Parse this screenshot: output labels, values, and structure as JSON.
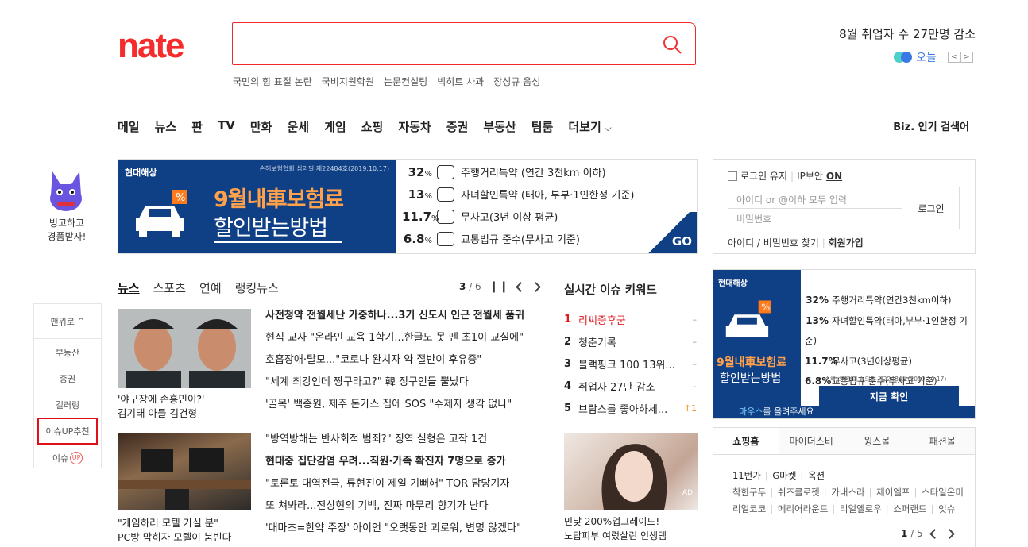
{
  "header": {
    "logo": "nate",
    "search_placeholder": "",
    "suggestions": [
      "국민의 힘 표절 논란",
      "국비지원학원",
      "논문컨설팅",
      "빅히트 사과",
      "장성규 음성"
    ],
    "headline": "8월 취업자 수 27만명 감소",
    "today_label": "오늘",
    "prev": "<",
    "next": ">"
  },
  "nav": {
    "items": [
      "메일",
      "뉴스",
      "판",
      "TV",
      "만화",
      "운세",
      "게임",
      "쇼핑",
      "자동차",
      "증권",
      "부동산",
      "팀룸"
    ],
    "more": "더보기",
    "biz": "Biz. 인기 검색어"
  },
  "left": {
    "mascot_text_1": "빙고하고",
    "mascot_text_2": "경품받자!",
    "top_label": "맨위로",
    "items": [
      "부동산",
      "증권",
      "컬러링",
      "이슈UP추천"
    ],
    "last_item": "이슈",
    "up_badge": "UP"
  },
  "banner": {
    "brand": "현대해상",
    "cert": "손해보험협회 심의필 제22484호(2019.10.17)",
    "headline_1": "9월내車보험료",
    "headline_2": "할인받는방법",
    "lines": [
      {
        "pct": "32",
        "text": "주행거리특약 (연간 3천km 이하)"
      },
      {
        "pct": "13",
        "text": "자녀할인특약 (태아, 부부·1인한정 기준)"
      },
      {
        "pct": "11.7",
        "text": "무사고(3년 이상 평균)"
      },
      {
        "pct": "6.8",
        "text": "교통법규 준수(무사고 기준)"
      }
    ],
    "pct_unit": "%",
    "go": "GO"
  },
  "login": {
    "keep": "로그인 유지",
    "ip_security": "IP보안",
    "ip_state": "ON",
    "id_placeholder": "아이디 or @이하 모두 입력",
    "pw_placeholder": "비밀번호",
    "button": "로그인",
    "find": "아이디 / 비밀번호 찾기",
    "join": "회원가입"
  },
  "news": {
    "tabs": [
      "뉴스",
      "스포츠",
      "연예",
      "랭킹뉴스"
    ],
    "page_current": "3",
    "page_total": "/ 6",
    "caption1_1": "'야구장에 손흥민이?'",
    "caption1_2": "김기태 아들 김건형",
    "caption2_1": "\"게임하러 모텔 가실 분\"",
    "caption2_2": "PC방 막히자 모텔이 붐빈다",
    "list1": [
      "사전청약 전월세난 가중하나...3기 신도시 인근 전월세 품귀",
      "현직 교사 \"온라인 교육 1학기...한글도 못 뗀 초1이 교실에\"",
      "호흡장애·탈모...\"코로나 완치자 약 절반이 후유증\"",
      "\"세계 최강인데 짱구라고?\" 韓 정구인들 뿔났다",
      "'골목' 백종원, 제주 돈가스 집에 SOS \"수제자 생각 없나\""
    ],
    "list2": [
      "\"방역방해는 반사회적 범죄?\" 징역 실형은 고작 1건",
      "현대중 집단감염 우려...직원·가족 확진자 7명으로 증가",
      "\"토론토 대역전극, 류현진이 제일 기뻐해\" TOR 담당기자",
      "또 쳐봐라...전상현의 기백, 진짜 마무리 향기가 난다",
      "'대마초=한약 주장' 아이언 \"오랫동안 괴로워, 변명 않겠다\""
    ]
  },
  "keywords": {
    "title": "실시간 이슈 키워드",
    "items": [
      {
        "rank": "1",
        "text": "리씨증후군",
        "delta": "–"
      },
      {
        "rank": "2",
        "text": "청춘기록",
        "delta": "–"
      },
      {
        "rank": "3",
        "text": "블랙핑크 100 13위...",
        "delta": "–"
      },
      {
        "rank": "4",
        "text": "취업자 27만 감소",
        "delta": "–"
      },
      {
        "rank": "5",
        "text": "브람스를 좋아하세...",
        "delta": "↑1"
      }
    ]
  },
  "ad_small": {
    "label": "AD",
    "line1": "민낯 200%업그레이드!",
    "line2": "노답피부 여렀살린 인생템"
  },
  "right_ad": {
    "brand": "현대해상",
    "h1": "9월내車보험료",
    "h2": "할인받는방법",
    "lines": [
      {
        "pct": "32%",
        "text": "주행거리특약(연간3천km이하)"
      },
      {
        "pct": "13%",
        "text": "자녀할인특약(태아,부부·1인한정 기준)"
      },
      {
        "pct": "11.7%",
        "text": "무사고(3년이상평균)"
      },
      {
        "pct": "6.8%",
        "text": "교통법규 준수(무사고 기준)"
      }
    ],
    "cert": "손해보험협회 심의필 제22484호(2019.10.17)",
    "confirm": "지금 확인",
    "mouse_hl": "마우스",
    "mouse_rest": "를 올려주세요"
  },
  "shopping": {
    "tabs": [
      "쇼핑홈",
      "마이더스비",
      "윙스몰",
      "패션몰"
    ],
    "row1": [
      "11번가",
      "G마켓",
      "옥션"
    ],
    "row2": [
      "착한구두",
      "쉬즈클로젯",
      "가내스라",
      "제이엘프",
      "스타일온미"
    ],
    "row3": [
      "리얼코코",
      "메리어라운드",
      "리얼옐로우",
      "쇼퍼랜드",
      "잇슈"
    ],
    "page_current": "1",
    "page_total": "/ 5"
  }
}
